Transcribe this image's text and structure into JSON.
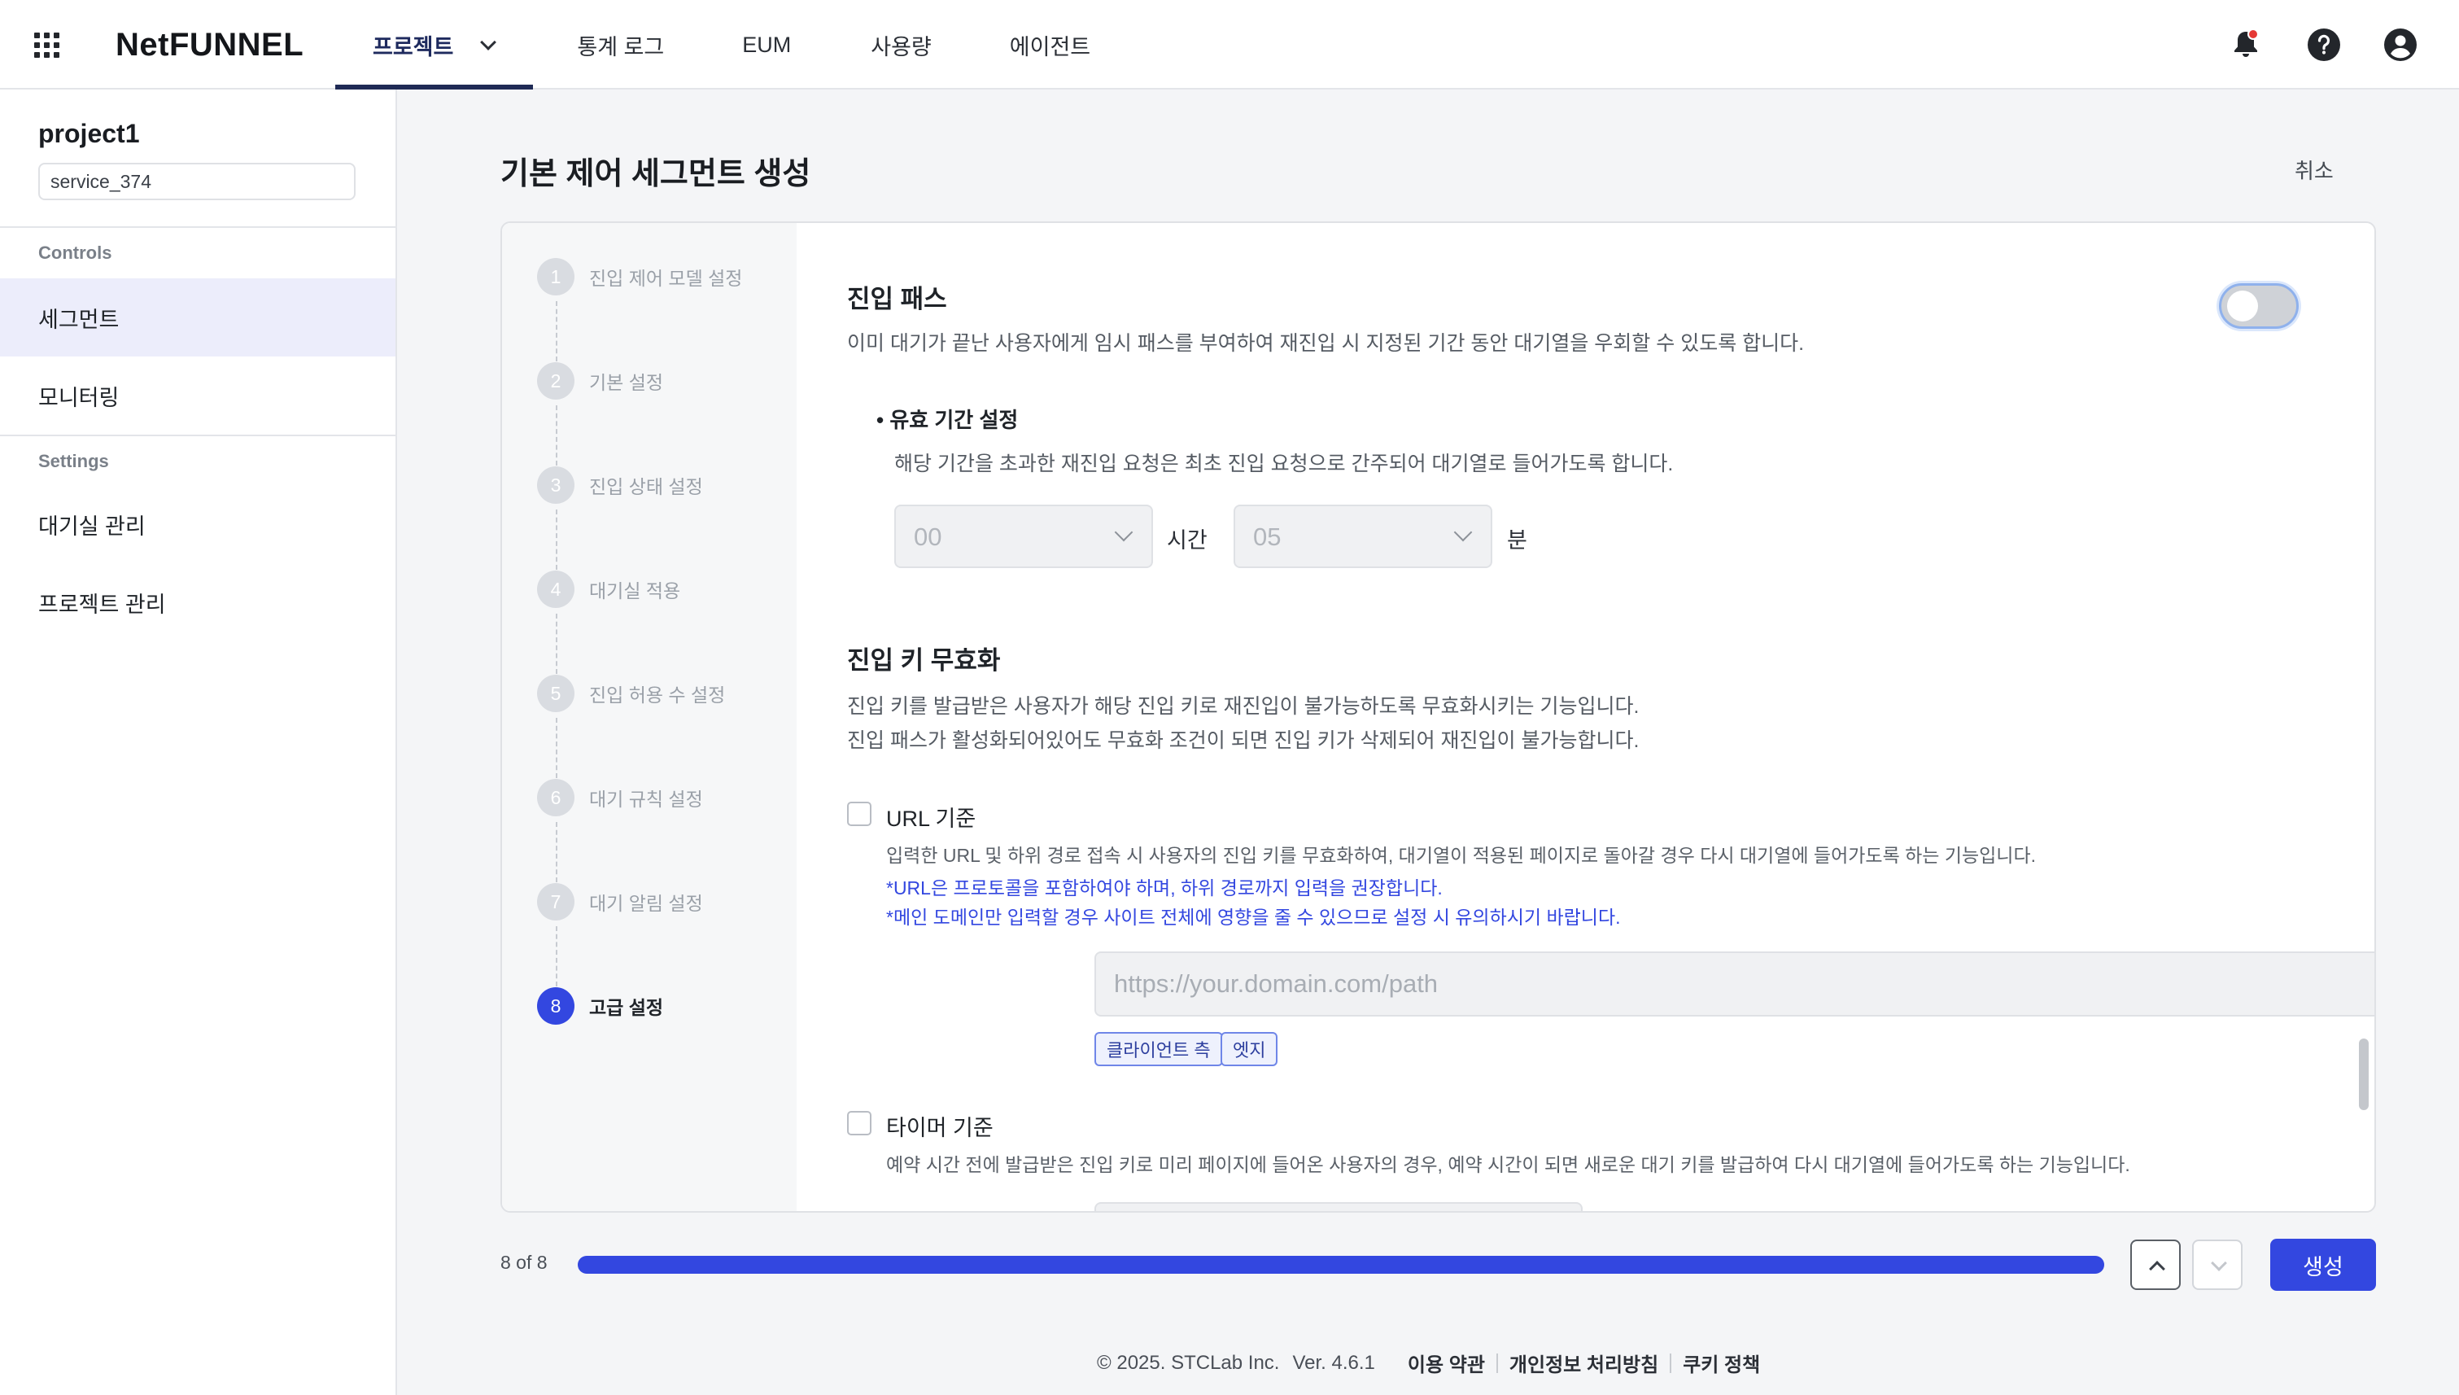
{
  "header": {
    "logo": "NetFUNNEL",
    "nav": [
      {
        "label": "프로젝트",
        "active": true
      },
      {
        "label": "통계 로그"
      },
      {
        "label": "EUM"
      },
      {
        "label": "사용량"
      },
      {
        "label": "에이전트"
      }
    ],
    "icons": [
      "apps-grid-icon",
      "bell-icon",
      "help-icon",
      "account-icon"
    ],
    "notification_dot_color": "#e53935"
  },
  "sidebar": {
    "project_name": "project1",
    "service_id": "service_374",
    "sections": [
      {
        "title": "Controls",
        "items": [
          {
            "label": "세그먼트",
            "active": true
          },
          {
            "label": "모니터링"
          }
        ]
      },
      {
        "title": "Settings",
        "items": [
          {
            "label": "대기실 관리"
          },
          {
            "label": "프로젝트 관리"
          }
        ]
      }
    ]
  },
  "page": {
    "title": "기본 제어 세그먼트 생성",
    "cancel_label": "취소"
  },
  "steps": [
    {
      "num": "1",
      "label": "진입 제어 모델 설정"
    },
    {
      "num": "2",
      "label": "기본 설정"
    },
    {
      "num": "3",
      "label": "진입 상태 설정"
    },
    {
      "num": "4",
      "label": "대기실 적용"
    },
    {
      "num": "5",
      "label": "진입 허용 수 설정"
    },
    {
      "num": "6",
      "label": "대기 규칙 설정"
    },
    {
      "num": "7",
      "label": "대기 알림 설정"
    },
    {
      "num": "8",
      "label": "고급 설정",
      "active": true
    }
  ],
  "entry_pass": {
    "title": "진입 패스",
    "description": "이미 대기가 끝난 사용자에게 임시 패스를 부여하여 재진입 시 지정된 기간 동안 대기열을 우회할 수 있도록 합니다.",
    "toggle_on": false,
    "validity": {
      "title": "유효 기간 설정",
      "description": "해당 기간을 초과한 재진입 요청은 최초 진입 요청으로 간주되어 대기열로 들어가도록 합니다.",
      "hours_value": "00",
      "hours_unit": "시간",
      "minutes_value": "05",
      "minutes_unit": "분"
    }
  },
  "key_invalidation": {
    "title": "진입 키 무효화",
    "description_1": "진입 키를 발급받은 사용자가 해당 진입 키로 재진입이 불가능하도록 무효화시키는 기능입니다.",
    "description_2": "진입 패스가 활성화되어있어도 무효화 조건이 되면 진입 키가 삭제되어 재진입이 불가능합니다.",
    "url_option": {
      "label": "URL 기준",
      "checked": false,
      "description": "입력한 URL 및 하위 경로 접속 시 사용자의 진입 키를 무효화하여, 대기열이 적용된 페이지로 돌아갈 경우 다시 대기열에 들어가도록 하는 기능입니다.",
      "note_1": "*URL은 프로토콜을 포함하여야 하며, 하위 경로까지 입력을 권장합니다.",
      "note_2": "*메인 도메인만 입력할 경우 사이트 전체에 영향을 줄 수 있으므로 설정 시 유의하시기 바랍니다.",
      "placeholder": "https://your.domain.com/path",
      "tags": [
        "클라이언트 측",
        "엣지"
      ]
    },
    "timer_option": {
      "label": "타이머 기준",
      "checked": false,
      "description": "예약 시간 전에 발급받은 진입 키로 미리 페이지에 들어온 사용자의 경우, 예약 시간이 되면 새로운 대기 키를 발급하여 다시 대기열에 들어가도록 하는 기능입니다."
    }
  },
  "progress": {
    "text": "8 of 8",
    "fraction": 1.0,
    "create_label": "생성"
  },
  "footer": {
    "copyright": "© 2025. STCLab Inc.",
    "version": "Ver. 4.6.1",
    "links": [
      "이용 약관",
      "개인정보 처리방침",
      "쿠키 정책"
    ]
  },
  "colors": {
    "accent": "#3347e0",
    "nav_active_underline": "#1f2a55",
    "sidebar_active_bg": "#ecedfb",
    "note_text": "#3347e0"
  }
}
